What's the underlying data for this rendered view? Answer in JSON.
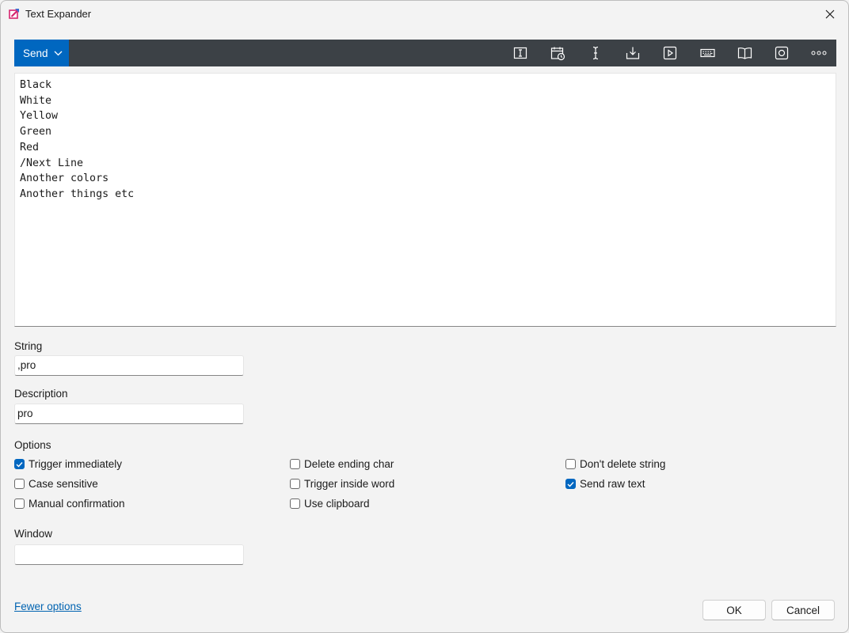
{
  "window": {
    "title": "Text Expander",
    "close_icon": "close-icon",
    "app_icon": "text-expander-app-icon"
  },
  "toolbar": {
    "send_label": "Send",
    "icons": [
      "insert-text-field-icon",
      "insert-date-time-icon",
      "insert-cursor-icon",
      "insert-clipboard-icon",
      "run-macro-icon",
      "insert-key-icon",
      "snippet-library-icon",
      "screenshot-capture-icon",
      "more-options-icon"
    ],
    "accent_color": "#0067c0",
    "bar_color": "#3c4146"
  },
  "editor": {
    "content": "Black\nWhite\nYellow\nGreen\nRed\n/Next Line\nAnother colors\nAnother things etc"
  },
  "fields": {
    "string_label": "String",
    "string_value": ",pro",
    "description_label": "Description",
    "description_value": "pro",
    "window_label": "Window",
    "window_value": ""
  },
  "options": {
    "label": "Options",
    "trigger_immediately": {
      "label": "Trigger immediately",
      "checked": true
    },
    "case_sensitive": {
      "label": "Case sensitive",
      "checked": false
    },
    "manual_confirmation": {
      "label": "Manual confirmation",
      "checked": false
    },
    "delete_ending_char": {
      "label": "Delete ending char",
      "checked": false
    },
    "trigger_inside_word": {
      "label": "Trigger inside word",
      "checked": false
    },
    "use_clipboard": {
      "label": "Use clipboard",
      "checked": false
    },
    "dont_delete_string": {
      "label": "Don't delete string",
      "checked": false
    },
    "send_raw_text": {
      "label": "Send raw text",
      "checked": true
    }
  },
  "footer": {
    "fewer_options_label": "Fewer options",
    "ok_label": "OK",
    "cancel_label": "Cancel"
  }
}
